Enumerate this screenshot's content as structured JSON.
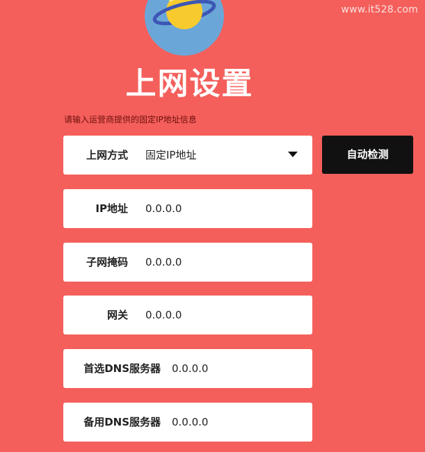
{
  "watermark": "www.it528.com",
  "header": {
    "logo_icon": "planet-logo-icon",
    "title": "上网设置"
  },
  "hint": "请输入运营商提供的固定IP地址信息",
  "connection": {
    "label": "上网方式",
    "value": "固定IP地址",
    "dropdown_icon": "caret-down-icon"
  },
  "detect_button": "自动检测",
  "fields": {
    "ip": {
      "label": "IP地址",
      "value": "0.0.0.0"
    },
    "mask": {
      "label": "子网掩码",
      "value": "0.0.0.0"
    },
    "gateway": {
      "label": "网关",
      "value": "0.0.0.0"
    },
    "dns_primary": {
      "label": "首选DNS服务器",
      "value": "0.0.0.0"
    },
    "dns_backup": {
      "label": "备用DNS服务器",
      "value": "0.0.0.0"
    }
  },
  "colors": {
    "background": "#f45f5b",
    "button_bg": "#111111",
    "planet": "#f7cb2e",
    "ring": "#3d56b5",
    "circle": "#6aa7d8"
  }
}
